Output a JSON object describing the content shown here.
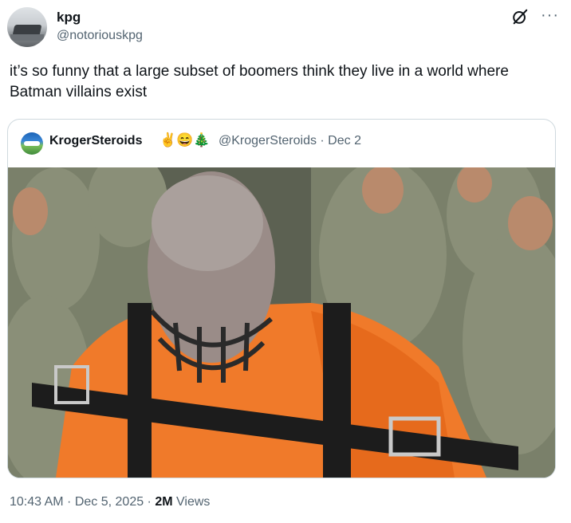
{
  "author": {
    "name": "kpg",
    "handle": "@notoriouskpg"
  },
  "tweet": {
    "text": "it’s so funny that a large subset of boomers think they live in a world where Batman villains exist"
  },
  "quoted": {
    "name": "KrogerSteroids",
    "emojis": "✌️😄🎄",
    "meta": "@KrogerSteroids · Dec 2"
  },
  "media": {
    "description": "photo-media"
  },
  "footer": {
    "time": "10:43 AM",
    "sep1": " · ",
    "date": "Dec 5, 2025",
    "sep2": " · ",
    "views_count": "2M",
    "views_label": " Views"
  },
  "colors": {
    "text": "#0f1419",
    "secondary": "#536471",
    "border": "#cfd9de",
    "inmate": "#f07a2a"
  },
  "icons": [
    "grok-icon",
    "more-icon"
  ]
}
